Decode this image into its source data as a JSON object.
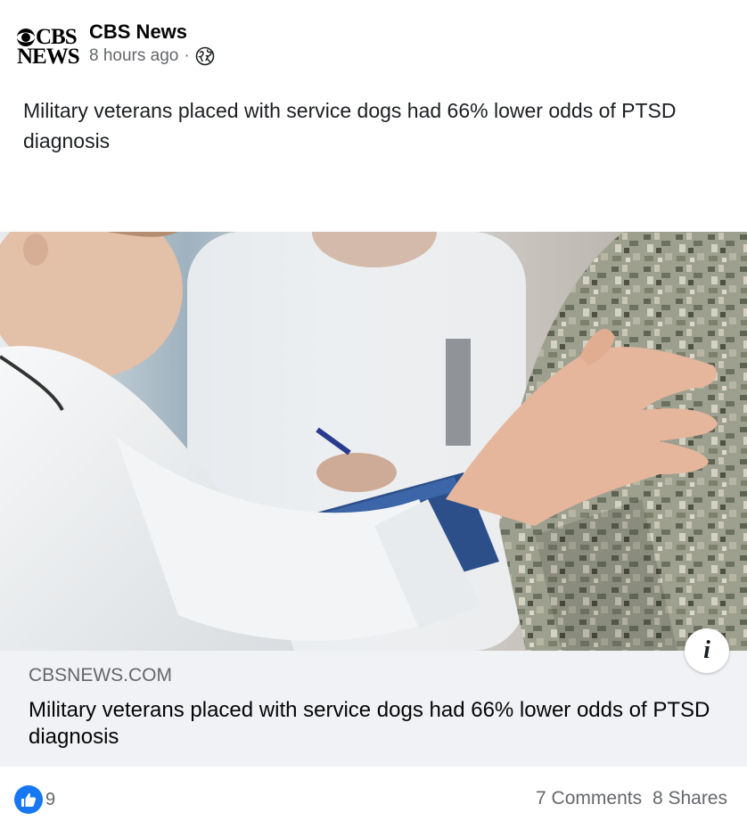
{
  "post": {
    "page_name": "CBS News",
    "logo_line1": "CBS",
    "logo_line2": "NEWS",
    "time": "8 hours ago",
    "separator": "·",
    "privacy_icon": "globe-icon",
    "text": "Military veterans placed with service dogs had 66% lower odds of PTSD diagnosis"
  },
  "link_preview": {
    "domain": "CBSNEWS.COM",
    "title": "Military veterans placed with service dogs had 66% lower odds of PTSD diagnosis",
    "info_label": "i"
  },
  "footer": {
    "reaction_icon": "like-icon",
    "reaction_count": "9",
    "comments": "7 Comments",
    "shares": "8 Shares"
  },
  "colors": {
    "like_blue": "#1877f2",
    "meta_gray": "#65676b",
    "link_bg": "#f0f2f5"
  }
}
